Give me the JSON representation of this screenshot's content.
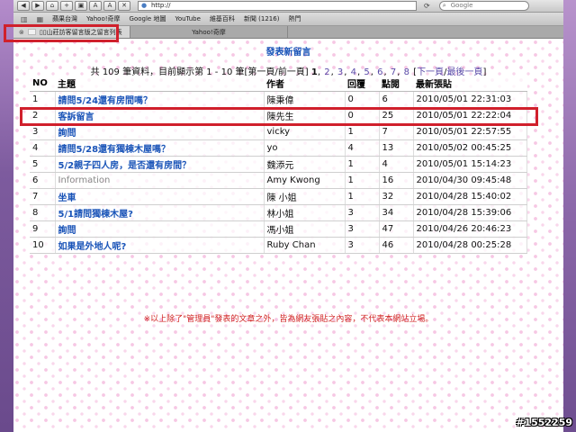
{
  "browser": {
    "url": "http://",
    "search_placeholder": "Google",
    "bookmarks": [
      "蘋果台灣",
      "Yahoo!奇摩",
      "Google 地圖",
      "YouTube",
      "維基百科",
      "新聞 (1216)",
      "熱門"
    ],
    "tabs": [
      {
        "label": "▯▯山莊訪客留言版之留言列表"
      },
      {
        "label": "Yahoo!奇摩"
      }
    ]
  },
  "page": {
    "post_link": "發表新留言",
    "pager": {
      "prefix": "共 109 筆資料，目前顯示第 1 - 10 筆[第一頁/前一頁]",
      "pages": [
        "1",
        "2",
        "3",
        "4",
        "5",
        "6",
        "7",
        "8"
      ],
      "current": "1",
      "suffix_open": "[",
      "next_label": "下一頁",
      "last_label": "最後一頁",
      "suffix_close": "]"
    },
    "table": {
      "headers": [
        "NO",
        "主題",
        "作者",
        "回覆",
        "點閱",
        "最新張貼"
      ],
      "rows": [
        {
          "no": "1",
          "title": "請問5/24還有房間嗎？",
          "author": "陳秉偉",
          "replies": "0",
          "hits": "6",
          "latest": "2010/05/01 22:31:03"
        },
        {
          "no": "2",
          "title": "客訴留言",
          "author": "陳先生",
          "replies": "0",
          "hits": "25",
          "latest": "2010/05/01 22:22:04"
        },
        {
          "no": "3",
          "title": "詢問",
          "author": "vicky",
          "replies": "1",
          "hits": "7",
          "latest": "2010/05/01 22:57:55"
        },
        {
          "no": "4",
          "title": "請問5/28還有獨棟木屋嗎？",
          "author": "yo",
          "replies": "4",
          "hits": "13",
          "latest": "2010/05/02 00:45:25"
        },
        {
          "no": "5",
          "title": "5/2親子四人房，是否還有房間？",
          "author": "魏添元",
          "replies": "1",
          "hits": "4",
          "latest": "2010/05/01 15:14:23"
        },
        {
          "no": "6",
          "title": "Information",
          "author": "Amy Kwong",
          "replies": "1",
          "hits": "16",
          "latest": "2010/04/30 09:45:48"
        },
        {
          "no": "7",
          "title": "坐車",
          "author": "陳 小姐",
          "replies": "1",
          "hits": "32",
          "latest": "2010/04/28 15:40:02"
        },
        {
          "no": "8",
          "title": "5/1請問獨棟木屋?",
          "author": "林小姐",
          "replies": "3",
          "hits": "34",
          "latest": "2010/04/28 15:39:06"
        },
        {
          "no": "9",
          "title": "詢問",
          "author": "馮小姐",
          "replies": "3",
          "hits": "47",
          "latest": "2010/04/26 20:46:23"
        },
        {
          "no": "10",
          "title": "如果是外地人呢?",
          "author": "Ruby Chan",
          "replies": "3",
          "hits": "46",
          "latest": "2010/04/28 00:25:28"
        }
      ]
    },
    "disclaimer": "※以上除了\"管理員\"發表的文章之外，皆為網友張貼之內容，不代表本網站立場。"
  },
  "watermark": "#1552259",
  "colors": {
    "link": "#1a54b8",
    "highlight_box": "#d0202c",
    "disclaimer": "#d02020"
  }
}
